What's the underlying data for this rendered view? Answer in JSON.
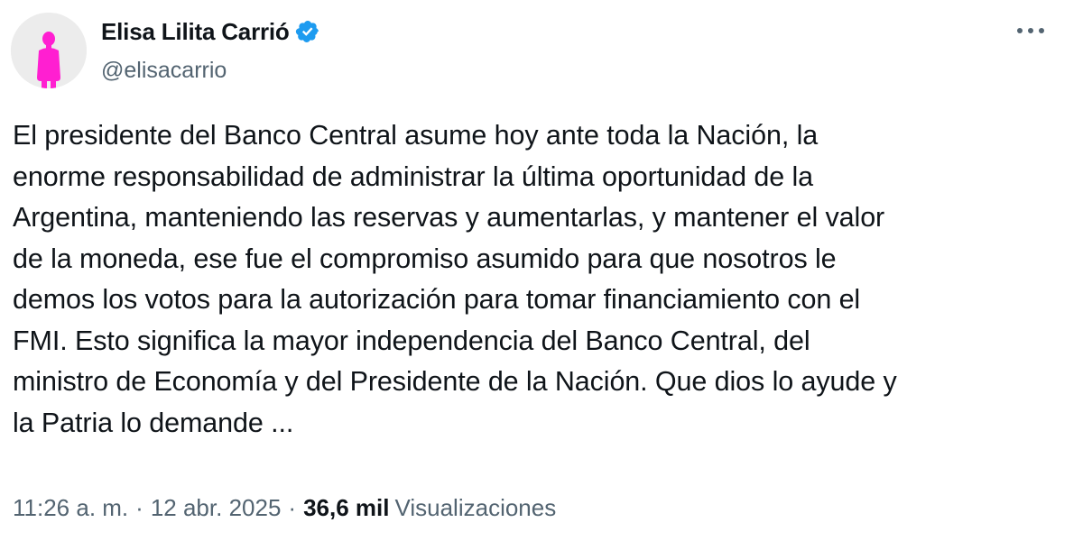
{
  "author": {
    "display_name": "Elisa Lilita Carrió",
    "handle": "@elisacarrio",
    "verified": true,
    "verified_icon": "verified-badge-icon",
    "verified_color": "#1d9bf0",
    "avatar_icon": "pink-figure-avatar",
    "avatar_color": "#ff1fd1"
  },
  "menu": {
    "icon": "more-options-icon",
    "label": "···"
  },
  "tweet": {
    "text": "El presidente del Banco Central  asume hoy ante toda la Nación, la\nenorme responsabilidad de administrar la última oportunidad de la\nArgentina, manteniendo las reservas y aumentarlas, y mantener el valor\nde la moneda, ese fue el compromiso asumido para que nosotros le\ndemos los votos para la autorización para tomar financiamiento con el\nFMI. Esto significa la mayor independencia del Banco Central, del\nministro de Economía y del Presidente de la Nación. Que dios lo ayude y\nla Patria lo demande ..."
  },
  "meta": {
    "time": "11:26 a. m.",
    "separator": "·",
    "date": "12 abr. 2025",
    "views_count": "36,6 mil",
    "views_label": "Visualizaciones"
  }
}
